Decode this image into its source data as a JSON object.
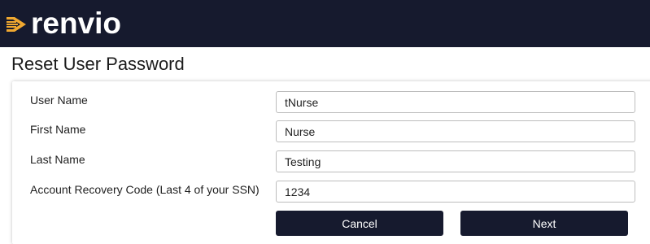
{
  "brand": {
    "name": "renvio",
    "accent": "#f0a830",
    "bar_color": "#161a2e"
  },
  "page_title": "Reset User Password",
  "form": {
    "fields": [
      {
        "label": "User Name",
        "value": "tNurse"
      },
      {
        "label": "First Name",
        "value": "Nurse"
      },
      {
        "label": "Last Name",
        "value": "Testing"
      },
      {
        "label": "Account Recovery Code (Last 4 of your SSN)",
        "value": "1234"
      }
    ],
    "cancel_label": "Cancel",
    "next_label": "Next"
  }
}
